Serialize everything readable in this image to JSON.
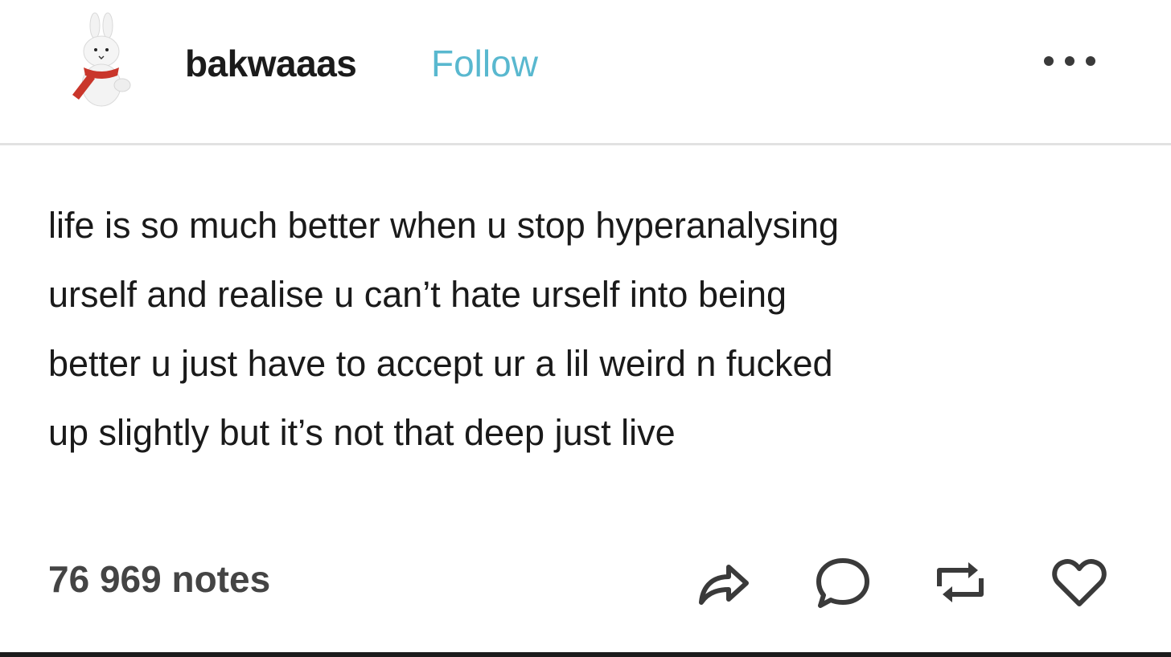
{
  "post": {
    "username": "bakwaaas",
    "follow_label": "Follow",
    "avatar_icon": "miffy-bunny-plush-avatar",
    "more_icon": "more-options-icon",
    "body_lines": [
      "life is so much better when u stop hyperanalysing",
      "urself and realise u can’t hate urself into being",
      "better u just have to accept ur a lil weird n fucked",
      "up slightly but it’s not that deep just live"
    ],
    "notes": "76 969 notes",
    "actions": [
      "share-icon",
      "reply-icon",
      "reblog-icon",
      "like-icon"
    ]
  },
  "colors": {
    "follow": "#59b8cf",
    "text": "#1a1a1a",
    "notes": "#444444",
    "icon": "#3a3a3a",
    "divider": "#e2e2e2"
  }
}
